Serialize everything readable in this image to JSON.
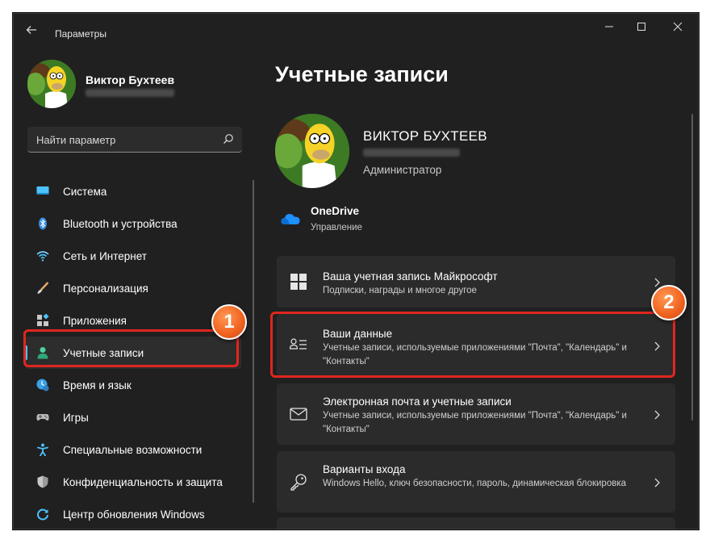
{
  "window": {
    "title": "Параметры",
    "controls": [
      "minimize",
      "maximize",
      "close"
    ]
  },
  "user": {
    "name": "Виктор Бухтеев"
  },
  "search": {
    "placeholder": "Найти параметр"
  },
  "sidebar": {
    "items": [
      {
        "label": "Система",
        "icon": "system-icon",
        "active": false
      },
      {
        "label": "Bluetooth и устройства",
        "icon": "bluetooth-icon",
        "active": false
      },
      {
        "label": "Сеть и Интернет",
        "icon": "wifi-icon",
        "active": false
      },
      {
        "label": "Персонализация",
        "icon": "brush-icon",
        "active": false
      },
      {
        "label": "Приложения",
        "icon": "apps-icon",
        "active": false
      },
      {
        "label": "Учетные записи",
        "icon": "person-icon",
        "active": true
      },
      {
        "label": "Время и язык",
        "icon": "clock-globe-icon",
        "active": false
      },
      {
        "label": "Игры",
        "icon": "gamepad-icon",
        "active": false
      },
      {
        "label": "Специальные возможности",
        "icon": "accessibility-icon",
        "active": false
      },
      {
        "label": "Конфиденциальность и защита",
        "icon": "shield-icon",
        "active": false
      },
      {
        "label": "Центр обновления Windows",
        "icon": "update-icon",
        "active": false
      }
    ]
  },
  "main": {
    "title": "Учетные записи",
    "profile": {
      "name": "ВИКТОР БУХТЕЕВ",
      "role": "Администратор"
    },
    "onedrive": {
      "title": "OneDrive",
      "subtitle": "Управление"
    },
    "cards": [
      {
        "title": "Ваша учетная запись Майкрософт",
        "subtitle": "Подписки, награды и многое другое",
        "icon": "windows-logo-icon"
      },
      {
        "title": "Ваши данные",
        "subtitle": "Учетные записи, используемые приложениями \"Почта\", \"Календарь\" и \"Контакты\"",
        "icon": "person-list-icon"
      },
      {
        "title": "Электронная почта и учетные записи",
        "subtitle": "Учетные записи, используемые приложениями \"Почта\", \"Календарь\" и \"Контакты\"",
        "icon": "mail-icon"
      },
      {
        "title": "Варианты входа",
        "subtitle": "Windows Hello, ключ безопасности, пароль, динамическая блокировка",
        "icon": "key-icon"
      }
    ]
  },
  "annotations": {
    "badge1": "1",
    "badge2": "2",
    "color": "#e0261f"
  },
  "colors": {
    "accent": "#4cc2ff",
    "background": "#202020",
    "card": "#2b2b2b"
  }
}
